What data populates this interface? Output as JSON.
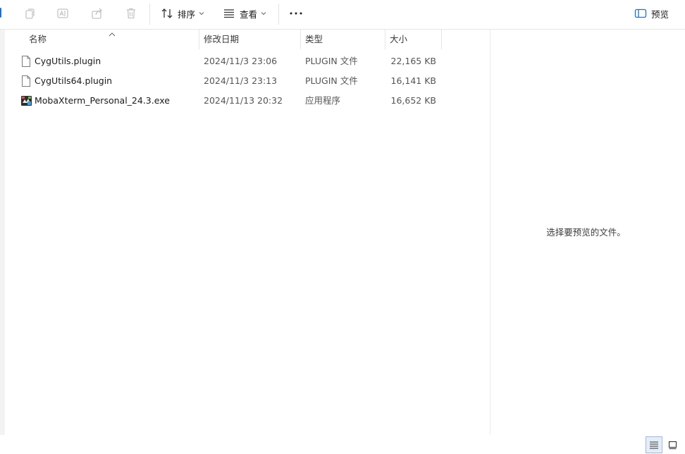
{
  "toolbar": {
    "sort_label": "排序",
    "view_label": "查看",
    "more_label": "···",
    "preview_label": "预览"
  },
  "columns": {
    "name": "名称",
    "modified": "修改日期",
    "type": "类型",
    "size": "大小"
  },
  "files": [
    {
      "name": "CygUtils.plugin",
      "modified": "2024/11/3 23:06",
      "type": "PLUGIN 文件",
      "size": "22,165 KB",
      "icon": "generic-file-icon"
    },
    {
      "name": "CygUtils64.plugin",
      "modified": "2024/11/3 23:13",
      "type": "PLUGIN 文件",
      "size": "16,141 KB",
      "icon": "generic-file-icon"
    },
    {
      "name": "MobaXterm_Personal_24.3.exe",
      "modified": "2024/11/13 20:32",
      "type": "应用程序",
      "size": "16,652 KB",
      "icon": "mobaxterm-app-icon"
    }
  ],
  "preview": {
    "empty_message": "选择要预览的文件。"
  },
  "colors": {
    "accent": "#1c6fd1",
    "disabled_icon": "#c4c4c4"
  }
}
